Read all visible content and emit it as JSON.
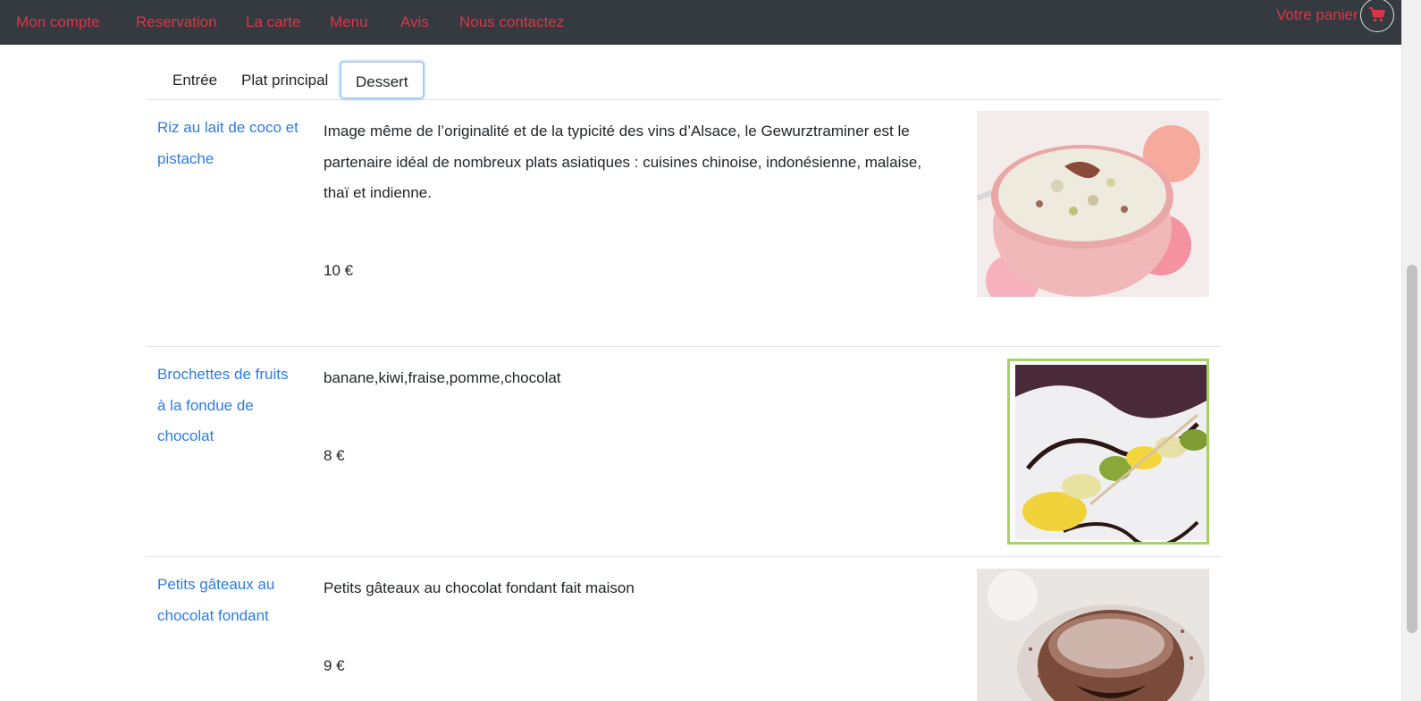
{
  "nav": {
    "links": [
      "Mon compte",
      "Reservation",
      "La carte",
      "Menu",
      "Avis",
      "Nous contactez"
    ],
    "cart_label": "Votre panier",
    "cart_icon": "shopping-cart-icon",
    "accent_color": "#dc3545",
    "bar_color": "#343a40"
  },
  "tabs": {
    "items": [
      "Entrée",
      "Plat principal",
      "Dessert"
    ],
    "active": "Dessert"
  },
  "dishes": [
    {
      "name": "Riz au lait de coco et pistache",
      "description": "Image même de l’originalité et de la typicité des vins d’Alsace, le Gewurztraminer est le partenaire idéal de nombreux plats asiatiques : cuisines chinoise, indonésienne, malaise, thaï et indienne.",
      "price": "10 €"
    },
    {
      "name": "Brochettes de fruits à la fondue de chocolat",
      "description": "banane,kiwi,fraise,pomme,chocolat",
      "price": "8 €"
    },
    {
      "name": "Petits gâteaux au chocolat fondant",
      "description": "Petits gâteaux au chocolat fondant fait maison",
      "price": "9 €"
    }
  ],
  "colors": {
    "link_blue": "#2c7be5",
    "text": "#212529"
  }
}
